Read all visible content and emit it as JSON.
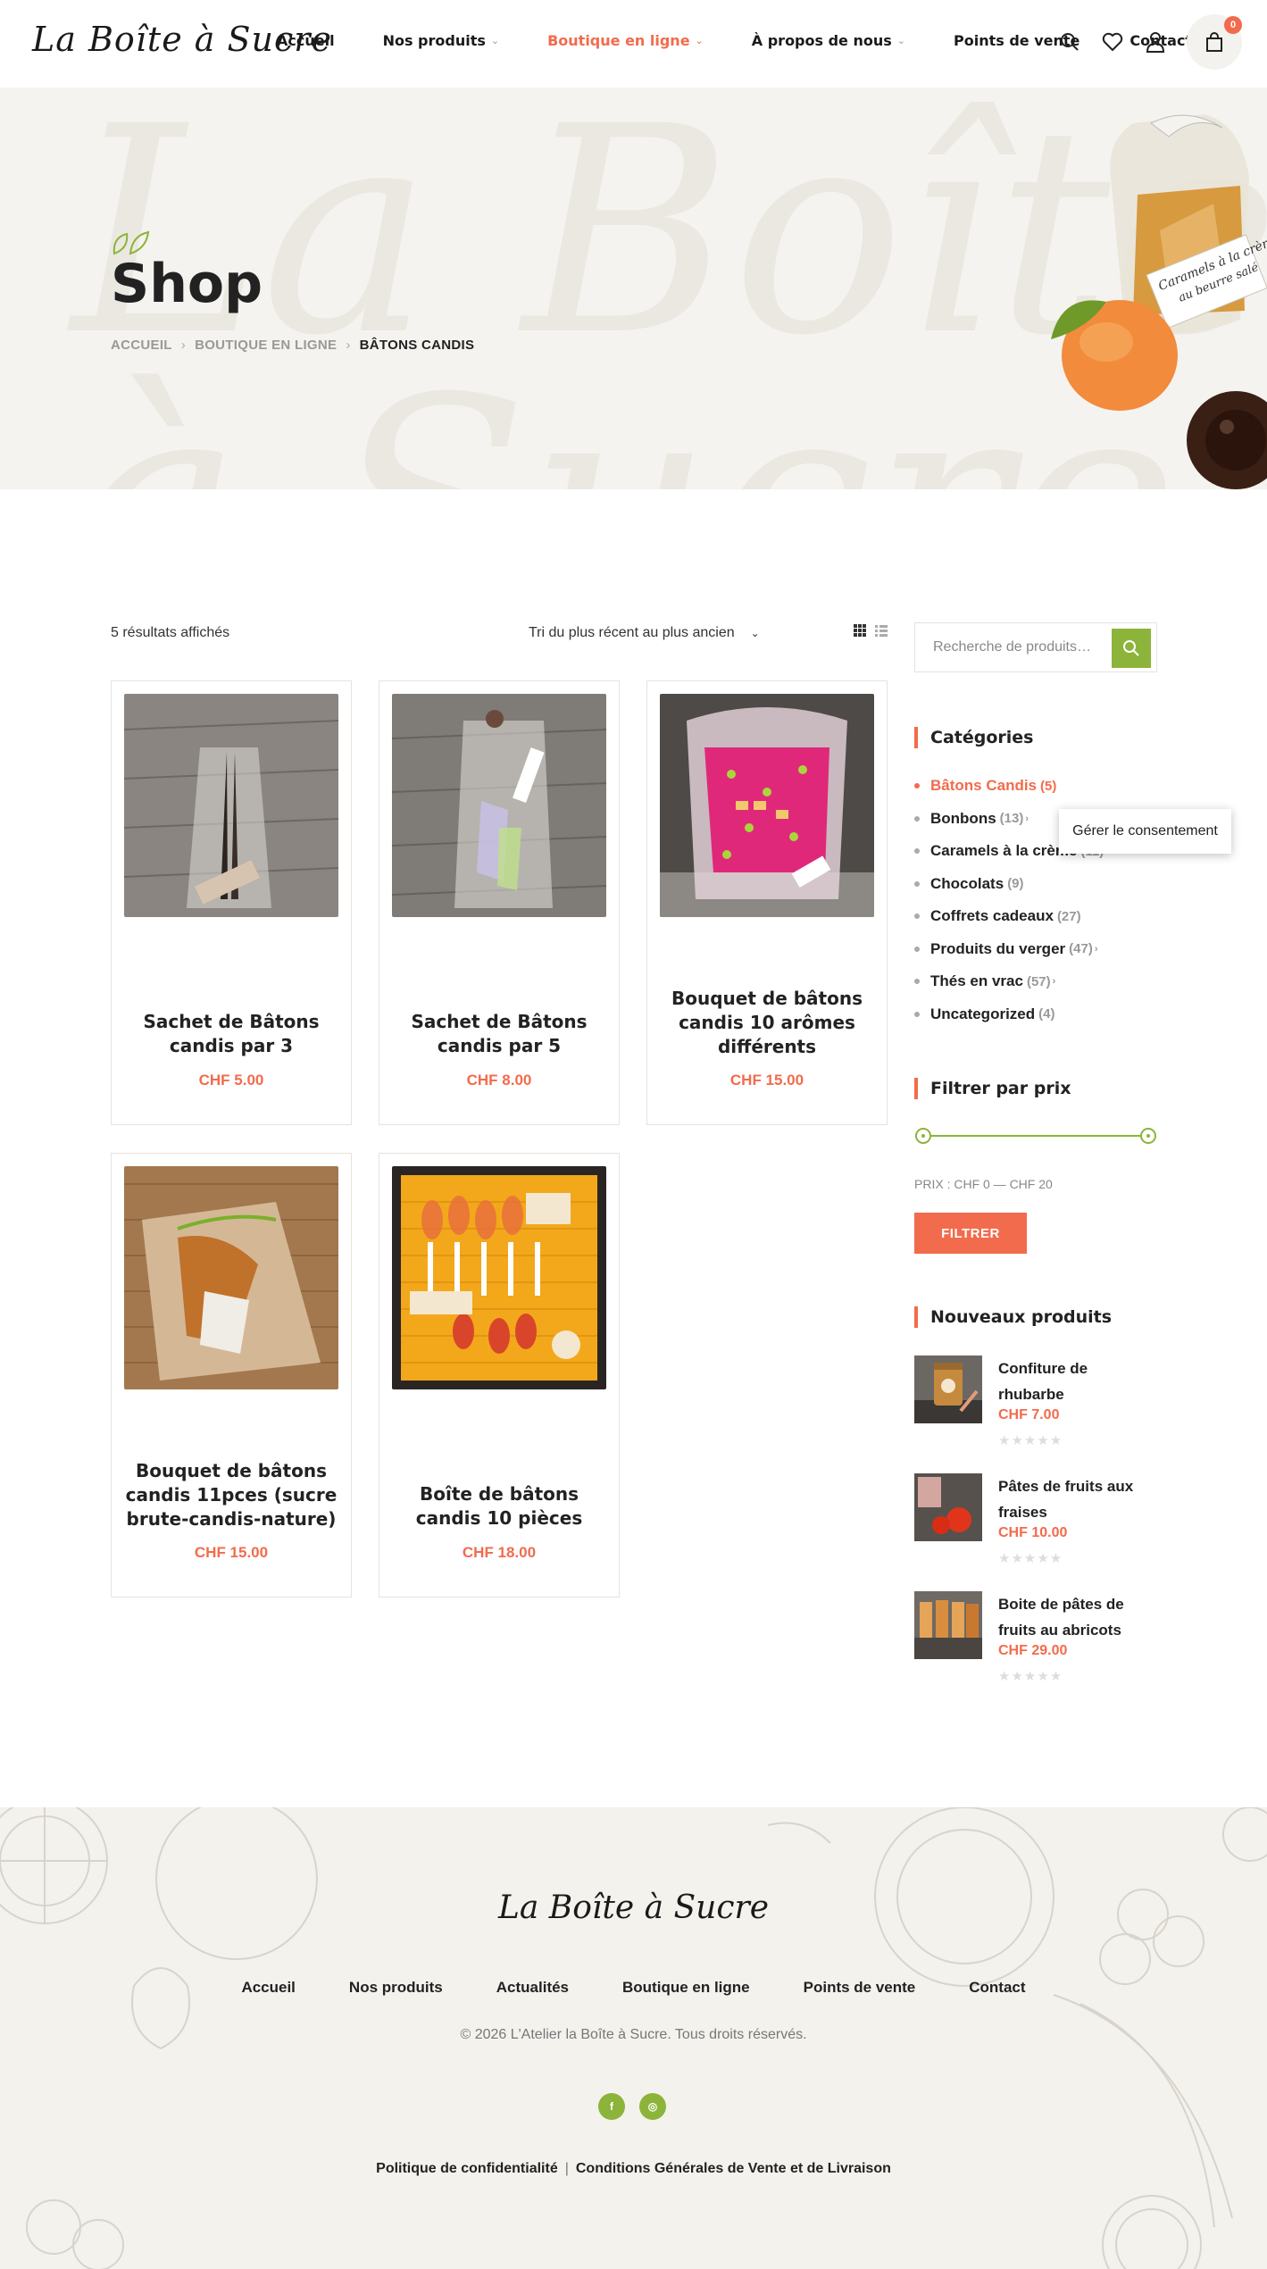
{
  "header": {
    "logo": "La Boîte à Sucre",
    "nav": [
      {
        "label": "Accueil",
        "has_dropdown": false,
        "active": false
      },
      {
        "label": "Nos produits",
        "has_dropdown": true,
        "active": false
      },
      {
        "label": "Boutique en ligne",
        "has_dropdown": true,
        "active": true
      },
      {
        "label": "À propos de nous",
        "has_dropdown": true,
        "active": false
      },
      {
        "label": "Points de vente",
        "has_dropdown": false,
        "active": false
      },
      {
        "label": "Contact",
        "has_dropdown": false,
        "active": false
      }
    ],
    "icons": [
      "search-icon",
      "heart-icon",
      "user-icon",
      "bag-icon"
    ],
    "cart_count": "0"
  },
  "hero": {
    "title": "Shop",
    "breadcrumb": [
      "ACCUEIL",
      "BOUTIQUE EN LIGNE",
      "BÂTONS CANDIS"
    ],
    "label_line1": "Caramels à la crème",
    "label_line2": "au beurre salé"
  },
  "toolbar": {
    "result_count": "5 résultats affichés",
    "sort": "Tri du plus récent au plus ancien"
  },
  "products": [
    {
      "title": "Sachet de Bâtons candis par 3",
      "price": "CHF 5.00"
    },
    {
      "title": "Sachet de Bâtons candis par 5",
      "price": "CHF 8.00"
    },
    {
      "title": "Bouquet de bâtons candis 10 arômes différents",
      "price": "CHF 15.00"
    },
    {
      "title": "Bouquet de bâtons candis 11pces (sucre brute-candis-nature)",
      "price": "CHF 15.00"
    },
    {
      "title": "Boîte de bâtons candis 10 pièces",
      "price": "CHF 18.00"
    }
  ],
  "sidebar": {
    "search_placeholder": "Recherche de produits…",
    "categories_title": "Catégories",
    "categories": [
      {
        "name": "Bâtons Candis",
        "count": "(5)",
        "active": true,
        "sub": false
      },
      {
        "name": "Bonbons",
        "count": "(13)",
        "active": false,
        "sub": true
      },
      {
        "name": "Caramels à la crème",
        "count": "(11)",
        "active": false,
        "sub": false
      },
      {
        "name": "Chocolats",
        "count": "(9)",
        "active": false,
        "sub": false
      },
      {
        "name": "Coffrets cadeaux",
        "count": "(27)",
        "active": false,
        "sub": false
      },
      {
        "name": "Produits du verger",
        "count": "(47)",
        "active": false,
        "sub": true
      },
      {
        "name": "Thés en vrac",
        "count": "(57)",
        "active": false,
        "sub": true
      },
      {
        "name": "Uncategorized",
        "count": "(4)",
        "active": false,
        "sub": false
      }
    ],
    "consent_popup": "Gérer le consentement",
    "price_filter_title": "Filtrer par prix",
    "price_range_label": "PRIX : CHF 0 — CHF 20",
    "filter_button": "FILTRER",
    "new_products_title": "Nouveaux produits",
    "new_products": [
      {
        "title": "Confiture de rhubarbe",
        "price": "CHF 7.00",
        "stars": "★★★★★"
      },
      {
        "title": "Pâtes de fruits aux fraises",
        "price": "CHF 10.00",
        "stars": "★★★★★"
      },
      {
        "title": "Boite de pâtes de fruits au abricots",
        "price": "CHF 29.00",
        "stars": "★★★★★"
      }
    ]
  },
  "footer": {
    "logo": "La Boîte à Sucre",
    "nav": [
      "Accueil",
      "Nos produits",
      "Actualités",
      "Boutique en ligne",
      "Points de vente",
      "Contact"
    ],
    "copyright": "© 2026 L'Atelier la Boîte à Sucre. Tous droits réservés.",
    "socials": [
      {
        "icon": "facebook-icon",
        "glyph": "f"
      },
      {
        "icon": "instagram-icon",
        "glyph": "◎"
      }
    ],
    "legal": [
      "Politique de confidentialité",
      "Conditions Générales de Vente et de Livraison"
    ],
    "legal_separator": "|"
  },
  "colors": {
    "accent": "#f26b4c",
    "green": "#8cb43a",
    "hero_bg": "#f5f3ef",
    "footer_bg": "#f4f2ed"
  }
}
